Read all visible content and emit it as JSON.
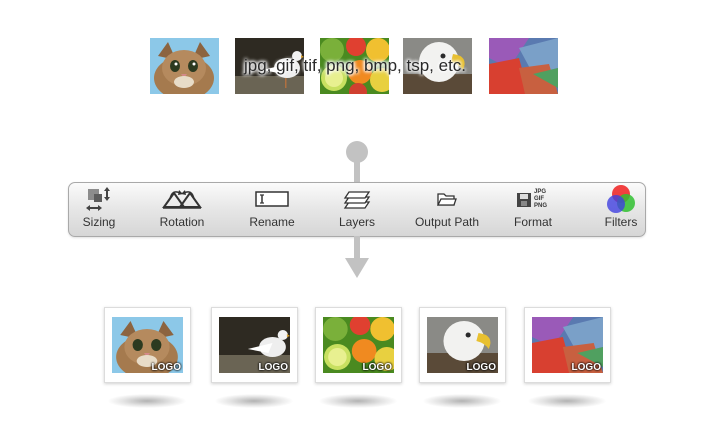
{
  "input_images": [
    {
      "name": "kitten"
    },
    {
      "name": "seagull"
    },
    {
      "name": "fruit"
    },
    {
      "name": "eagle"
    },
    {
      "name": "abstract"
    }
  ],
  "formats_text": "jpg, gif, tif, png, bmp, tsp, etc.",
  "toolbar": {
    "tools": [
      {
        "label": "Sizing",
        "icon": "sizing-icon"
      },
      {
        "label": "Rotation",
        "icon": "rotation-icon"
      },
      {
        "label": "Rename",
        "icon": "rename-icon"
      },
      {
        "label": "Layers",
        "icon": "layers-icon"
      },
      {
        "label": "Output Path",
        "icon": "folder-icon"
      },
      {
        "label": "Format",
        "icon": "format-icon"
      },
      {
        "label": "Filters",
        "icon": "filters-icon"
      }
    ],
    "format_icon_text": [
      "JPG",
      "GIF",
      "PNG"
    ]
  },
  "output_images": [
    {
      "name": "kitten",
      "watermark": "LOGO"
    },
    {
      "name": "seagull",
      "watermark": "LOGO"
    },
    {
      "name": "fruit",
      "watermark": "LOGO"
    },
    {
      "name": "eagle",
      "watermark": "LOGO"
    },
    {
      "name": "abstract",
      "watermark": "LOGO"
    }
  ]
}
